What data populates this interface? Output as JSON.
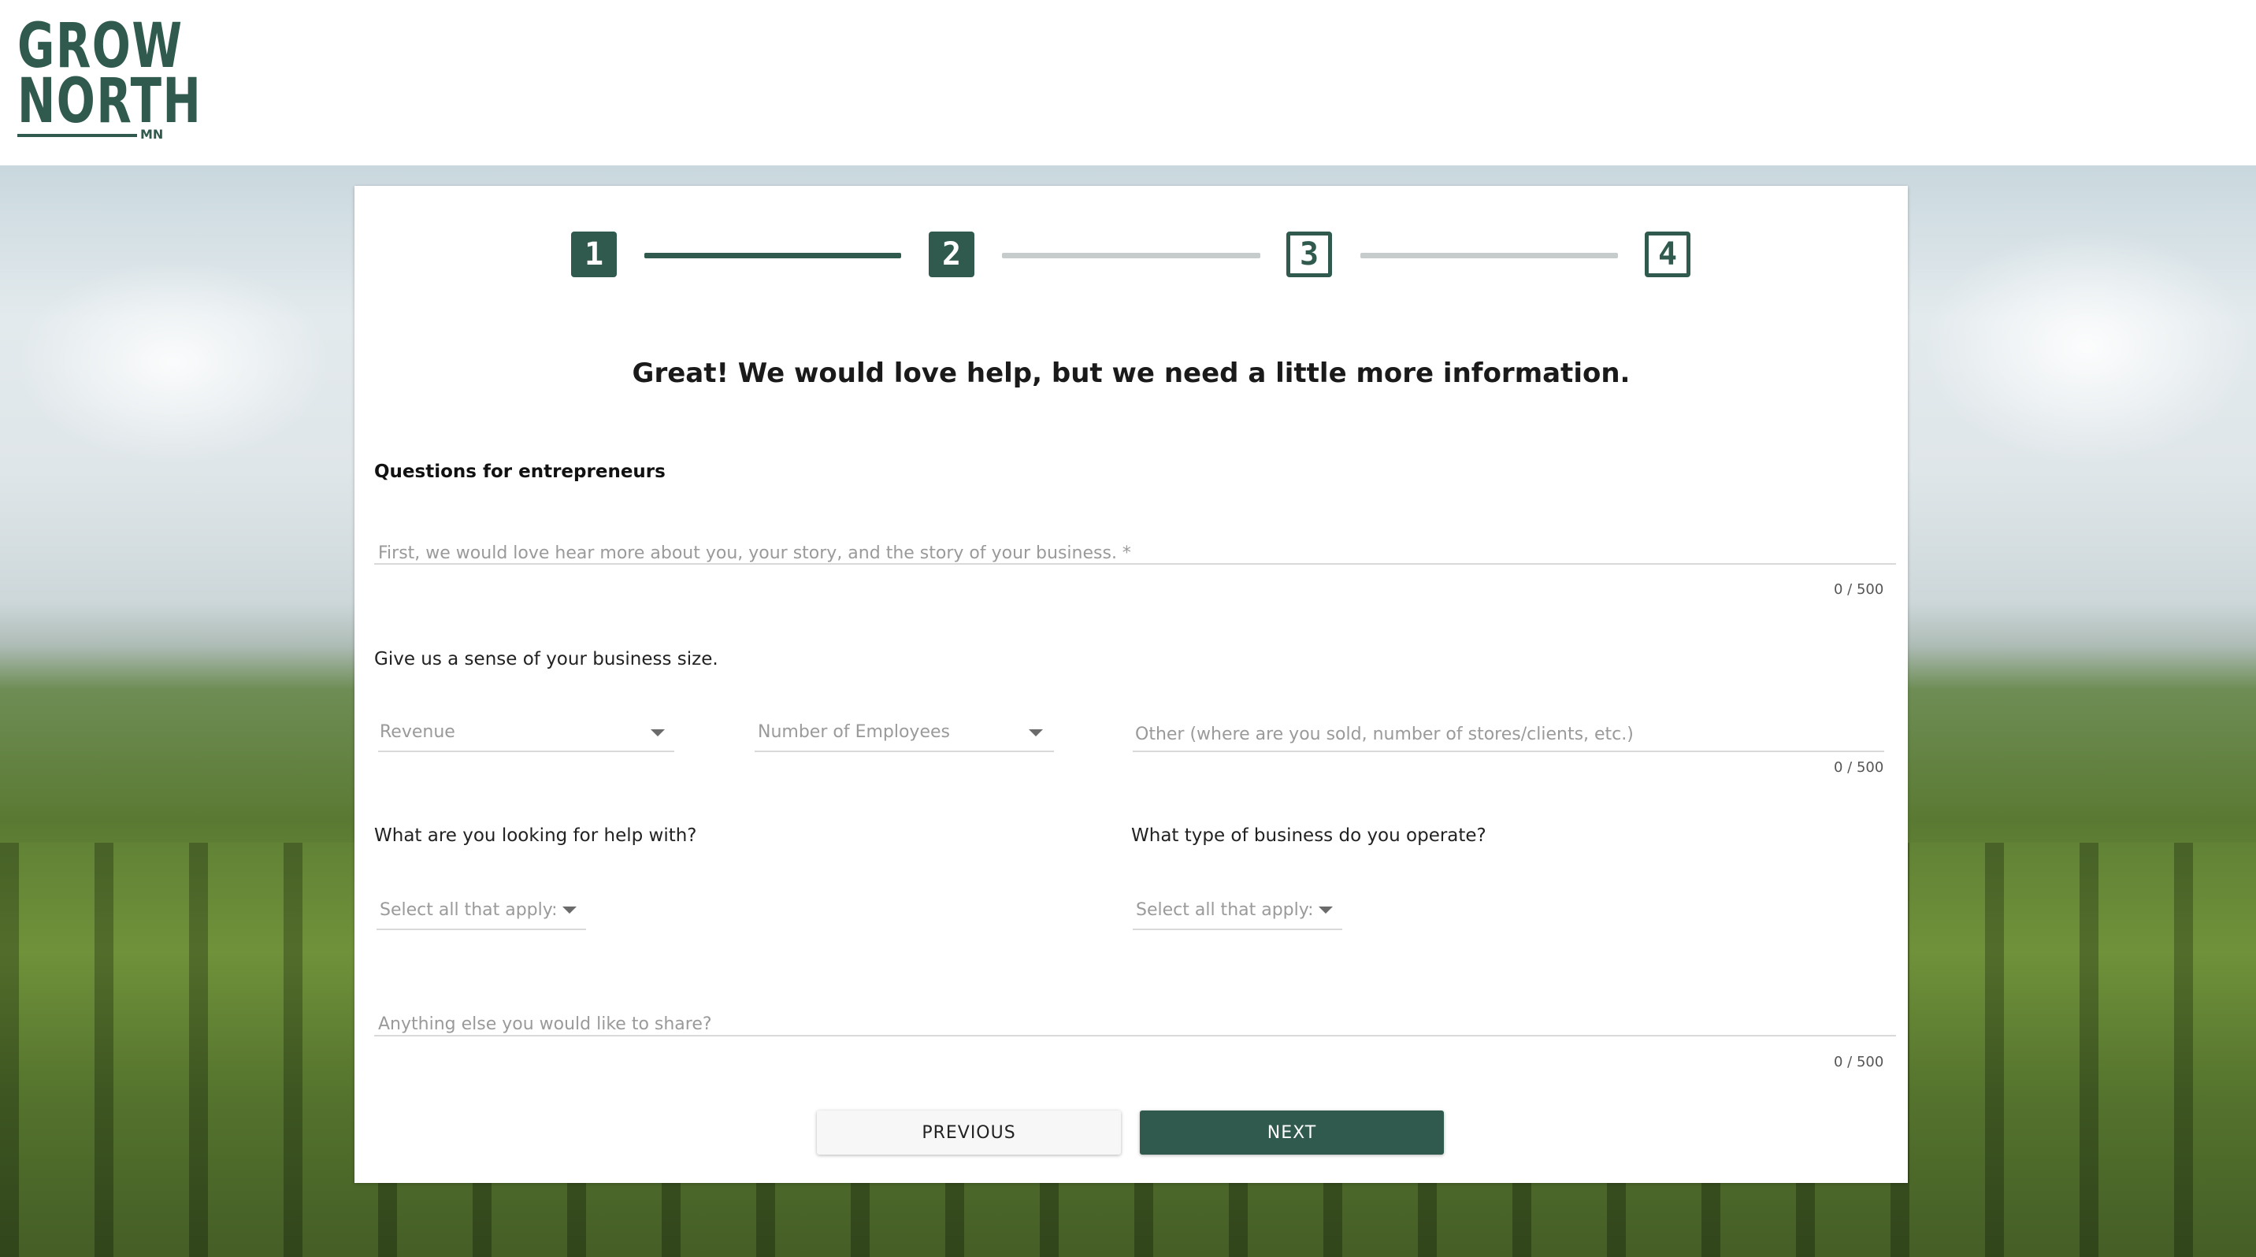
{
  "logo": {
    "line1": "GROW",
    "line2": "NORTH",
    "suffix": "MN"
  },
  "stepper": {
    "steps": [
      {
        "label": "1",
        "state": "active"
      },
      {
        "label": "2",
        "state": "active"
      },
      {
        "label": "3",
        "state": "inactive"
      },
      {
        "label": "4",
        "state": "inactive"
      }
    ],
    "colors": {
      "active": "#2f5a4d",
      "inactive_line": "#c5cccb"
    }
  },
  "form": {
    "heading": "Great! We would love help, but we need a little more information.",
    "section_title": "Questions for entrepreneurs",
    "story_field": {
      "placeholder": "First, we would love hear more about you, your story, and the story of your business. *",
      "counter": "0 / 500"
    },
    "business_size": {
      "label": "Give us a sense of your business size.",
      "revenue_placeholder": "Revenue",
      "employees_placeholder": "Number of Employees",
      "other_placeholder": "Other (where are you sold, number of stores/clients, etc.)",
      "other_counter": "0 / 500"
    },
    "help_with": {
      "label": "What are you looking for help with?",
      "placeholder": "Select all that apply:"
    },
    "business_type": {
      "label": "What type of business do you operate?",
      "placeholder": "Select all that apply:"
    },
    "anything_else": {
      "placeholder": "Anything else you would like to share?",
      "counter": "0 / 500"
    }
  },
  "buttons": {
    "previous": "PREVIOUS",
    "next": "NEXT"
  },
  "colors": {
    "brand": "#2f5a4d",
    "card": "#ffffff"
  }
}
